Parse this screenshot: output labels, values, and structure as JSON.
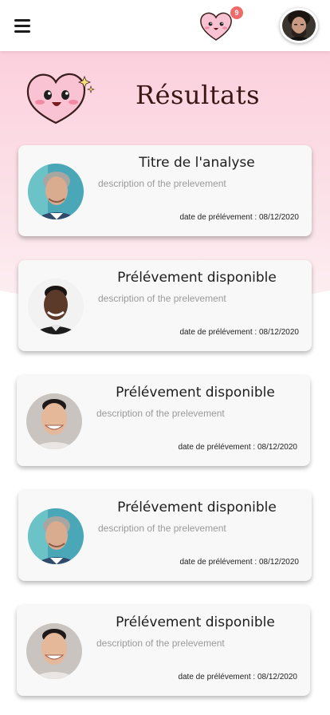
{
  "topbar": {
    "notification_count": "9"
  },
  "header": {
    "title": "Résultats"
  },
  "cards": [
    {
      "title": "Titre de l'analyse",
      "description": "description of the prelevement",
      "date": "date de prélévement : 08/12/2020",
      "avatar": "person-gray-hair"
    },
    {
      "title": "Prélévement disponible",
      "description": "description of the prelevement",
      "date": "date de prélévement : 08/12/2020",
      "avatar": "person-dark-skin"
    },
    {
      "title": "Prélévement disponible",
      "description": "description of the prelevement",
      "date": "date de prélévement : 08/12/2020",
      "avatar": "person-smiling"
    },
    {
      "title": "Prélévement disponible",
      "description": "description of the prelevement",
      "date": "date de prélévement : 08/12/2020",
      "avatar": "person-gray-hair"
    },
    {
      "title": "Prélévement disponible",
      "description": "description of the prelevement",
      "date": "date de prélévement : 08/12/2020",
      "avatar": "person-smiling"
    }
  ],
  "colors": {
    "accent_pink": "#fcd0dd",
    "badge": "#f06a6a",
    "title": "#3a1616"
  }
}
